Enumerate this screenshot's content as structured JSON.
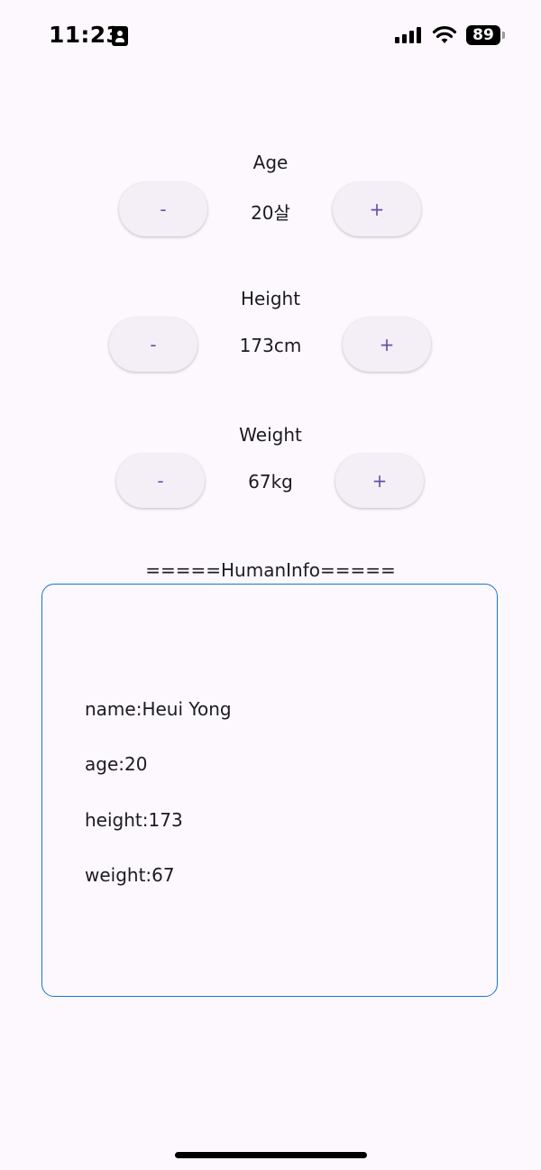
{
  "status_bar": {
    "time": "11:23",
    "battery": "89"
  },
  "age": {
    "label": "Age",
    "value": "20살",
    "minus": "-",
    "plus": "+"
  },
  "height": {
    "label": "Height",
    "value": "173cm",
    "minus": "-",
    "plus": "+"
  },
  "weight": {
    "label": "Weight",
    "value": "67kg",
    "minus": "-",
    "plus": "+"
  },
  "human_info": {
    "heading": "=====HumanInfo=====",
    "lines": [
      "name:Heui Yong",
      "age:20",
      "height:173",
      "weight:67"
    ]
  },
  "colors": {
    "background": "#fdf8fd",
    "button_bg": "#f4eff7",
    "button_text": "#6750a4",
    "box_border": "#1976d2"
  }
}
